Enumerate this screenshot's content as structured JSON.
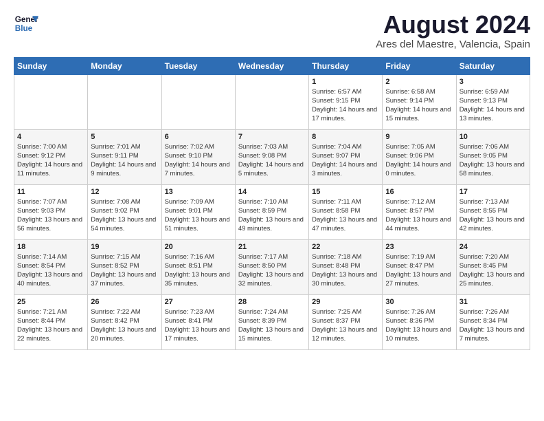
{
  "header": {
    "logo_line1": "General",
    "logo_line2": "Blue",
    "month_year": "August 2024",
    "location": "Ares del Maestre, Valencia, Spain"
  },
  "weekdays": [
    "Sunday",
    "Monday",
    "Tuesday",
    "Wednesday",
    "Thursday",
    "Friday",
    "Saturday"
  ],
  "weeks": [
    [
      {
        "day": "",
        "info": ""
      },
      {
        "day": "",
        "info": ""
      },
      {
        "day": "",
        "info": ""
      },
      {
        "day": "",
        "info": ""
      },
      {
        "day": "1",
        "info": "Sunrise: 6:57 AM\nSunset: 9:15 PM\nDaylight: 14 hours\nand 17 minutes."
      },
      {
        "day": "2",
        "info": "Sunrise: 6:58 AM\nSunset: 9:14 PM\nDaylight: 14 hours\nand 15 minutes."
      },
      {
        "day": "3",
        "info": "Sunrise: 6:59 AM\nSunset: 9:13 PM\nDaylight: 14 hours\nand 13 minutes."
      }
    ],
    [
      {
        "day": "4",
        "info": "Sunrise: 7:00 AM\nSunset: 9:12 PM\nDaylight: 14 hours\nand 11 minutes."
      },
      {
        "day": "5",
        "info": "Sunrise: 7:01 AM\nSunset: 9:11 PM\nDaylight: 14 hours\nand 9 minutes."
      },
      {
        "day": "6",
        "info": "Sunrise: 7:02 AM\nSunset: 9:10 PM\nDaylight: 14 hours\nand 7 minutes."
      },
      {
        "day": "7",
        "info": "Sunrise: 7:03 AM\nSunset: 9:08 PM\nDaylight: 14 hours\nand 5 minutes."
      },
      {
        "day": "8",
        "info": "Sunrise: 7:04 AM\nSunset: 9:07 PM\nDaylight: 14 hours\nand 3 minutes."
      },
      {
        "day": "9",
        "info": "Sunrise: 7:05 AM\nSunset: 9:06 PM\nDaylight: 14 hours\nand 0 minutes."
      },
      {
        "day": "10",
        "info": "Sunrise: 7:06 AM\nSunset: 9:05 PM\nDaylight: 13 hours\nand 58 minutes."
      }
    ],
    [
      {
        "day": "11",
        "info": "Sunrise: 7:07 AM\nSunset: 9:03 PM\nDaylight: 13 hours\nand 56 minutes."
      },
      {
        "day": "12",
        "info": "Sunrise: 7:08 AM\nSunset: 9:02 PM\nDaylight: 13 hours\nand 54 minutes."
      },
      {
        "day": "13",
        "info": "Sunrise: 7:09 AM\nSunset: 9:01 PM\nDaylight: 13 hours\nand 51 minutes."
      },
      {
        "day": "14",
        "info": "Sunrise: 7:10 AM\nSunset: 8:59 PM\nDaylight: 13 hours\nand 49 minutes."
      },
      {
        "day": "15",
        "info": "Sunrise: 7:11 AM\nSunset: 8:58 PM\nDaylight: 13 hours\nand 47 minutes."
      },
      {
        "day": "16",
        "info": "Sunrise: 7:12 AM\nSunset: 8:57 PM\nDaylight: 13 hours\nand 44 minutes."
      },
      {
        "day": "17",
        "info": "Sunrise: 7:13 AM\nSunset: 8:55 PM\nDaylight: 13 hours\nand 42 minutes."
      }
    ],
    [
      {
        "day": "18",
        "info": "Sunrise: 7:14 AM\nSunset: 8:54 PM\nDaylight: 13 hours\nand 40 minutes."
      },
      {
        "day": "19",
        "info": "Sunrise: 7:15 AM\nSunset: 8:52 PM\nDaylight: 13 hours\nand 37 minutes."
      },
      {
        "day": "20",
        "info": "Sunrise: 7:16 AM\nSunset: 8:51 PM\nDaylight: 13 hours\nand 35 minutes."
      },
      {
        "day": "21",
        "info": "Sunrise: 7:17 AM\nSunset: 8:50 PM\nDaylight: 13 hours\nand 32 minutes."
      },
      {
        "day": "22",
        "info": "Sunrise: 7:18 AM\nSunset: 8:48 PM\nDaylight: 13 hours\nand 30 minutes."
      },
      {
        "day": "23",
        "info": "Sunrise: 7:19 AM\nSunset: 8:47 PM\nDaylight: 13 hours\nand 27 minutes."
      },
      {
        "day": "24",
        "info": "Sunrise: 7:20 AM\nSunset: 8:45 PM\nDaylight: 13 hours\nand 25 minutes."
      }
    ],
    [
      {
        "day": "25",
        "info": "Sunrise: 7:21 AM\nSunset: 8:44 PM\nDaylight: 13 hours\nand 22 minutes."
      },
      {
        "day": "26",
        "info": "Sunrise: 7:22 AM\nSunset: 8:42 PM\nDaylight: 13 hours\nand 20 minutes."
      },
      {
        "day": "27",
        "info": "Sunrise: 7:23 AM\nSunset: 8:41 PM\nDaylight: 13 hours\nand 17 minutes."
      },
      {
        "day": "28",
        "info": "Sunrise: 7:24 AM\nSunset: 8:39 PM\nDaylight: 13 hours\nand 15 minutes."
      },
      {
        "day": "29",
        "info": "Sunrise: 7:25 AM\nSunset: 8:37 PM\nDaylight: 13 hours\nand 12 minutes."
      },
      {
        "day": "30",
        "info": "Sunrise: 7:26 AM\nSunset: 8:36 PM\nDaylight: 13 hours\nand 10 minutes."
      },
      {
        "day": "31",
        "info": "Sunrise: 7:26 AM\nSunset: 8:34 PM\nDaylight: 13 hours\nand 7 minutes."
      }
    ]
  ]
}
